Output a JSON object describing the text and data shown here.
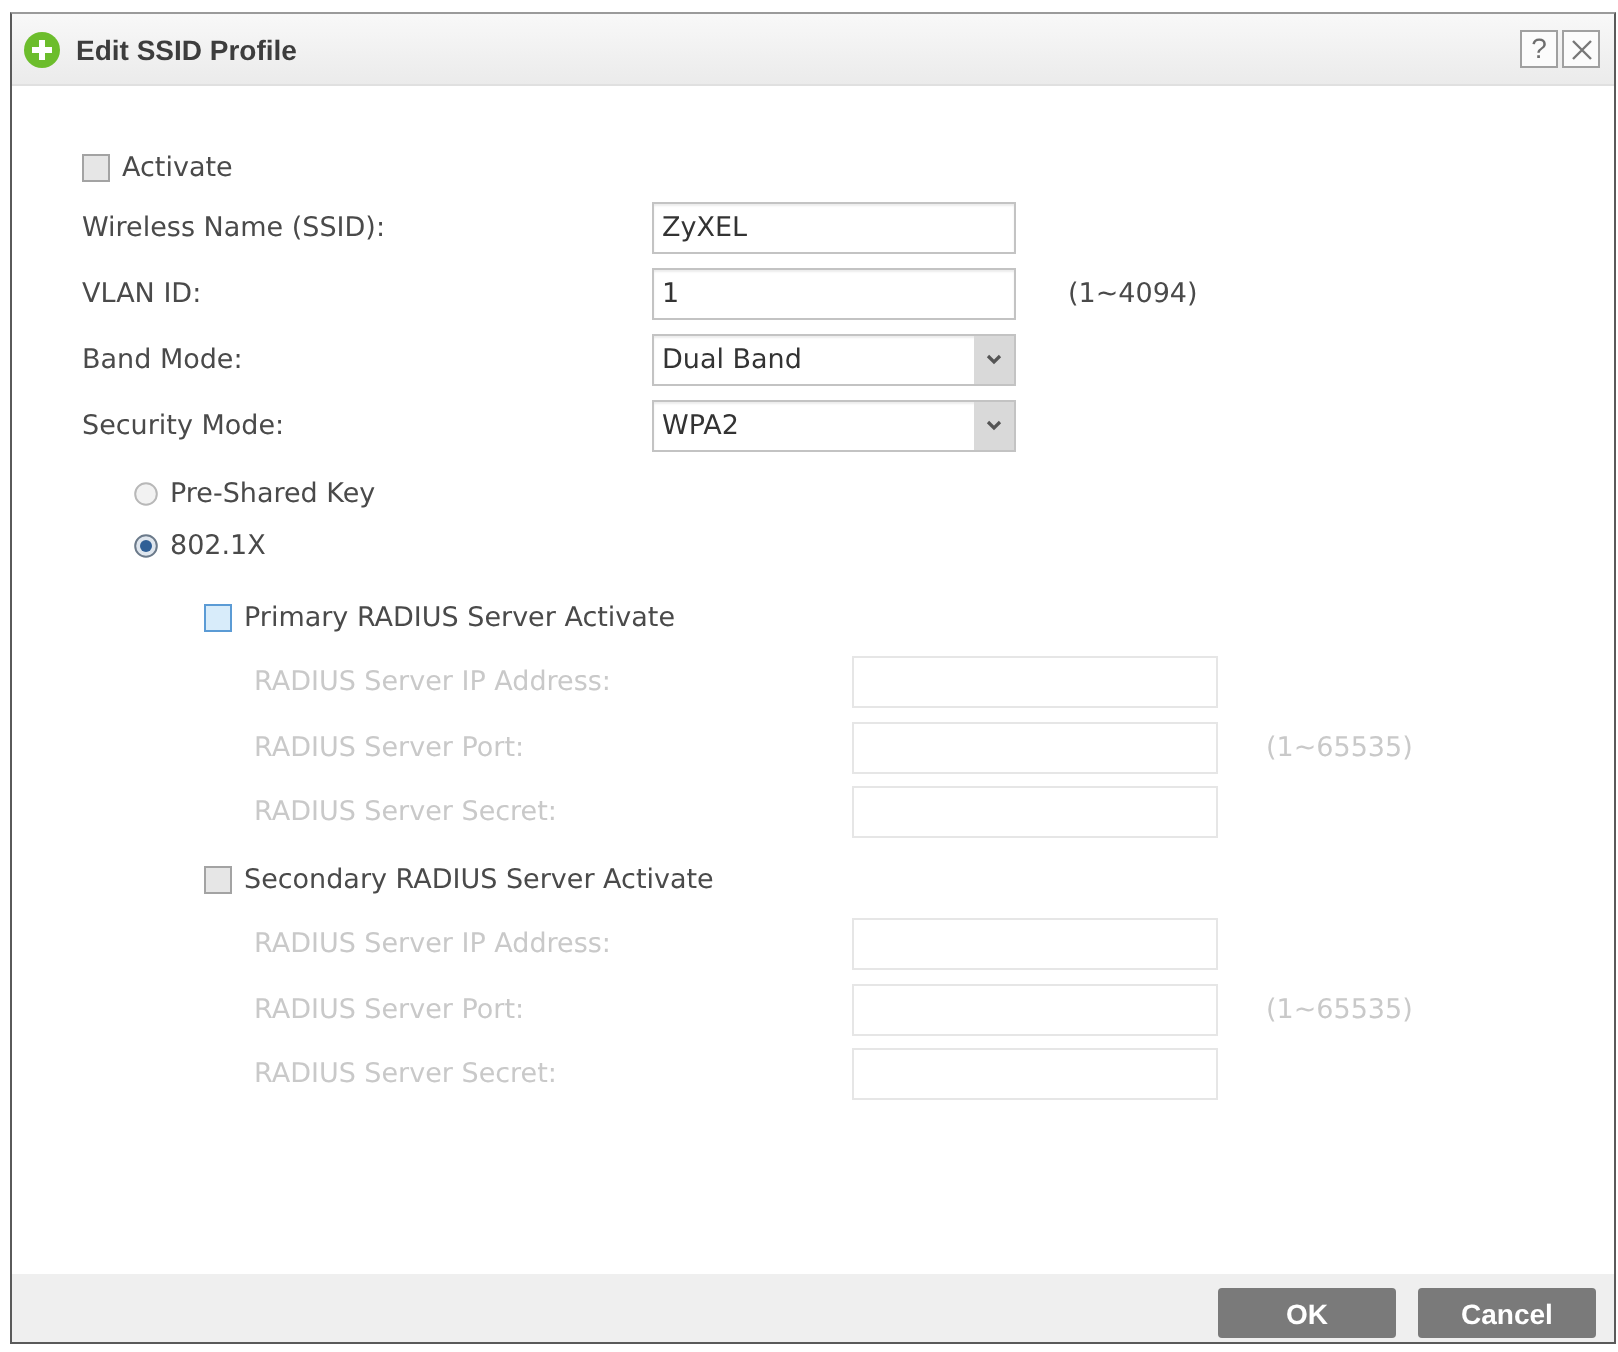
{
  "dialog": {
    "title": "Edit SSID Profile",
    "help_button": "?"
  },
  "activate": {
    "label": "Activate",
    "checked": false
  },
  "fields": [
    {
      "kind": "text",
      "label": "Wireless Name (SSID):",
      "value": "ZyXEL"
    },
    {
      "kind": "text",
      "label": "VLAN ID:",
      "value": "1",
      "hint": "(1~4094)"
    },
    {
      "kind": "select",
      "label": "Band Mode:",
      "value": "Dual Band"
    },
    {
      "kind": "select",
      "label": "Security Mode:",
      "value": "WPA2"
    }
  ],
  "security_options": [
    {
      "label": "Pre-Shared Key",
      "selected": false
    },
    {
      "label": "802.1X",
      "selected": true
    }
  ],
  "radius_servers": [
    {
      "label": "Primary RADIUS Server Activate",
      "checked": false,
      "focused": true,
      "fields": [
        {
          "label": "RADIUS Server IP Address:",
          "disabled": true
        },
        {
          "label": "RADIUS Server Port:",
          "hint": "(1~65535)",
          "disabled": true
        },
        {
          "label": "RADIUS Server Secret:",
          "disabled": true
        }
      ]
    },
    {
      "label": "Secondary RADIUS Server Activate",
      "checked": false,
      "focused": false,
      "fields": [
        {
          "label": "RADIUS Server IP Address:",
          "disabled": true
        },
        {
          "label": "RADIUS Server Port:",
          "hint": "(1~65535)",
          "disabled": true
        },
        {
          "label": "RADIUS Server Secret:",
          "disabled": true
        }
      ]
    }
  ],
  "buttons": [
    "OK",
    "Cancel"
  ]
}
